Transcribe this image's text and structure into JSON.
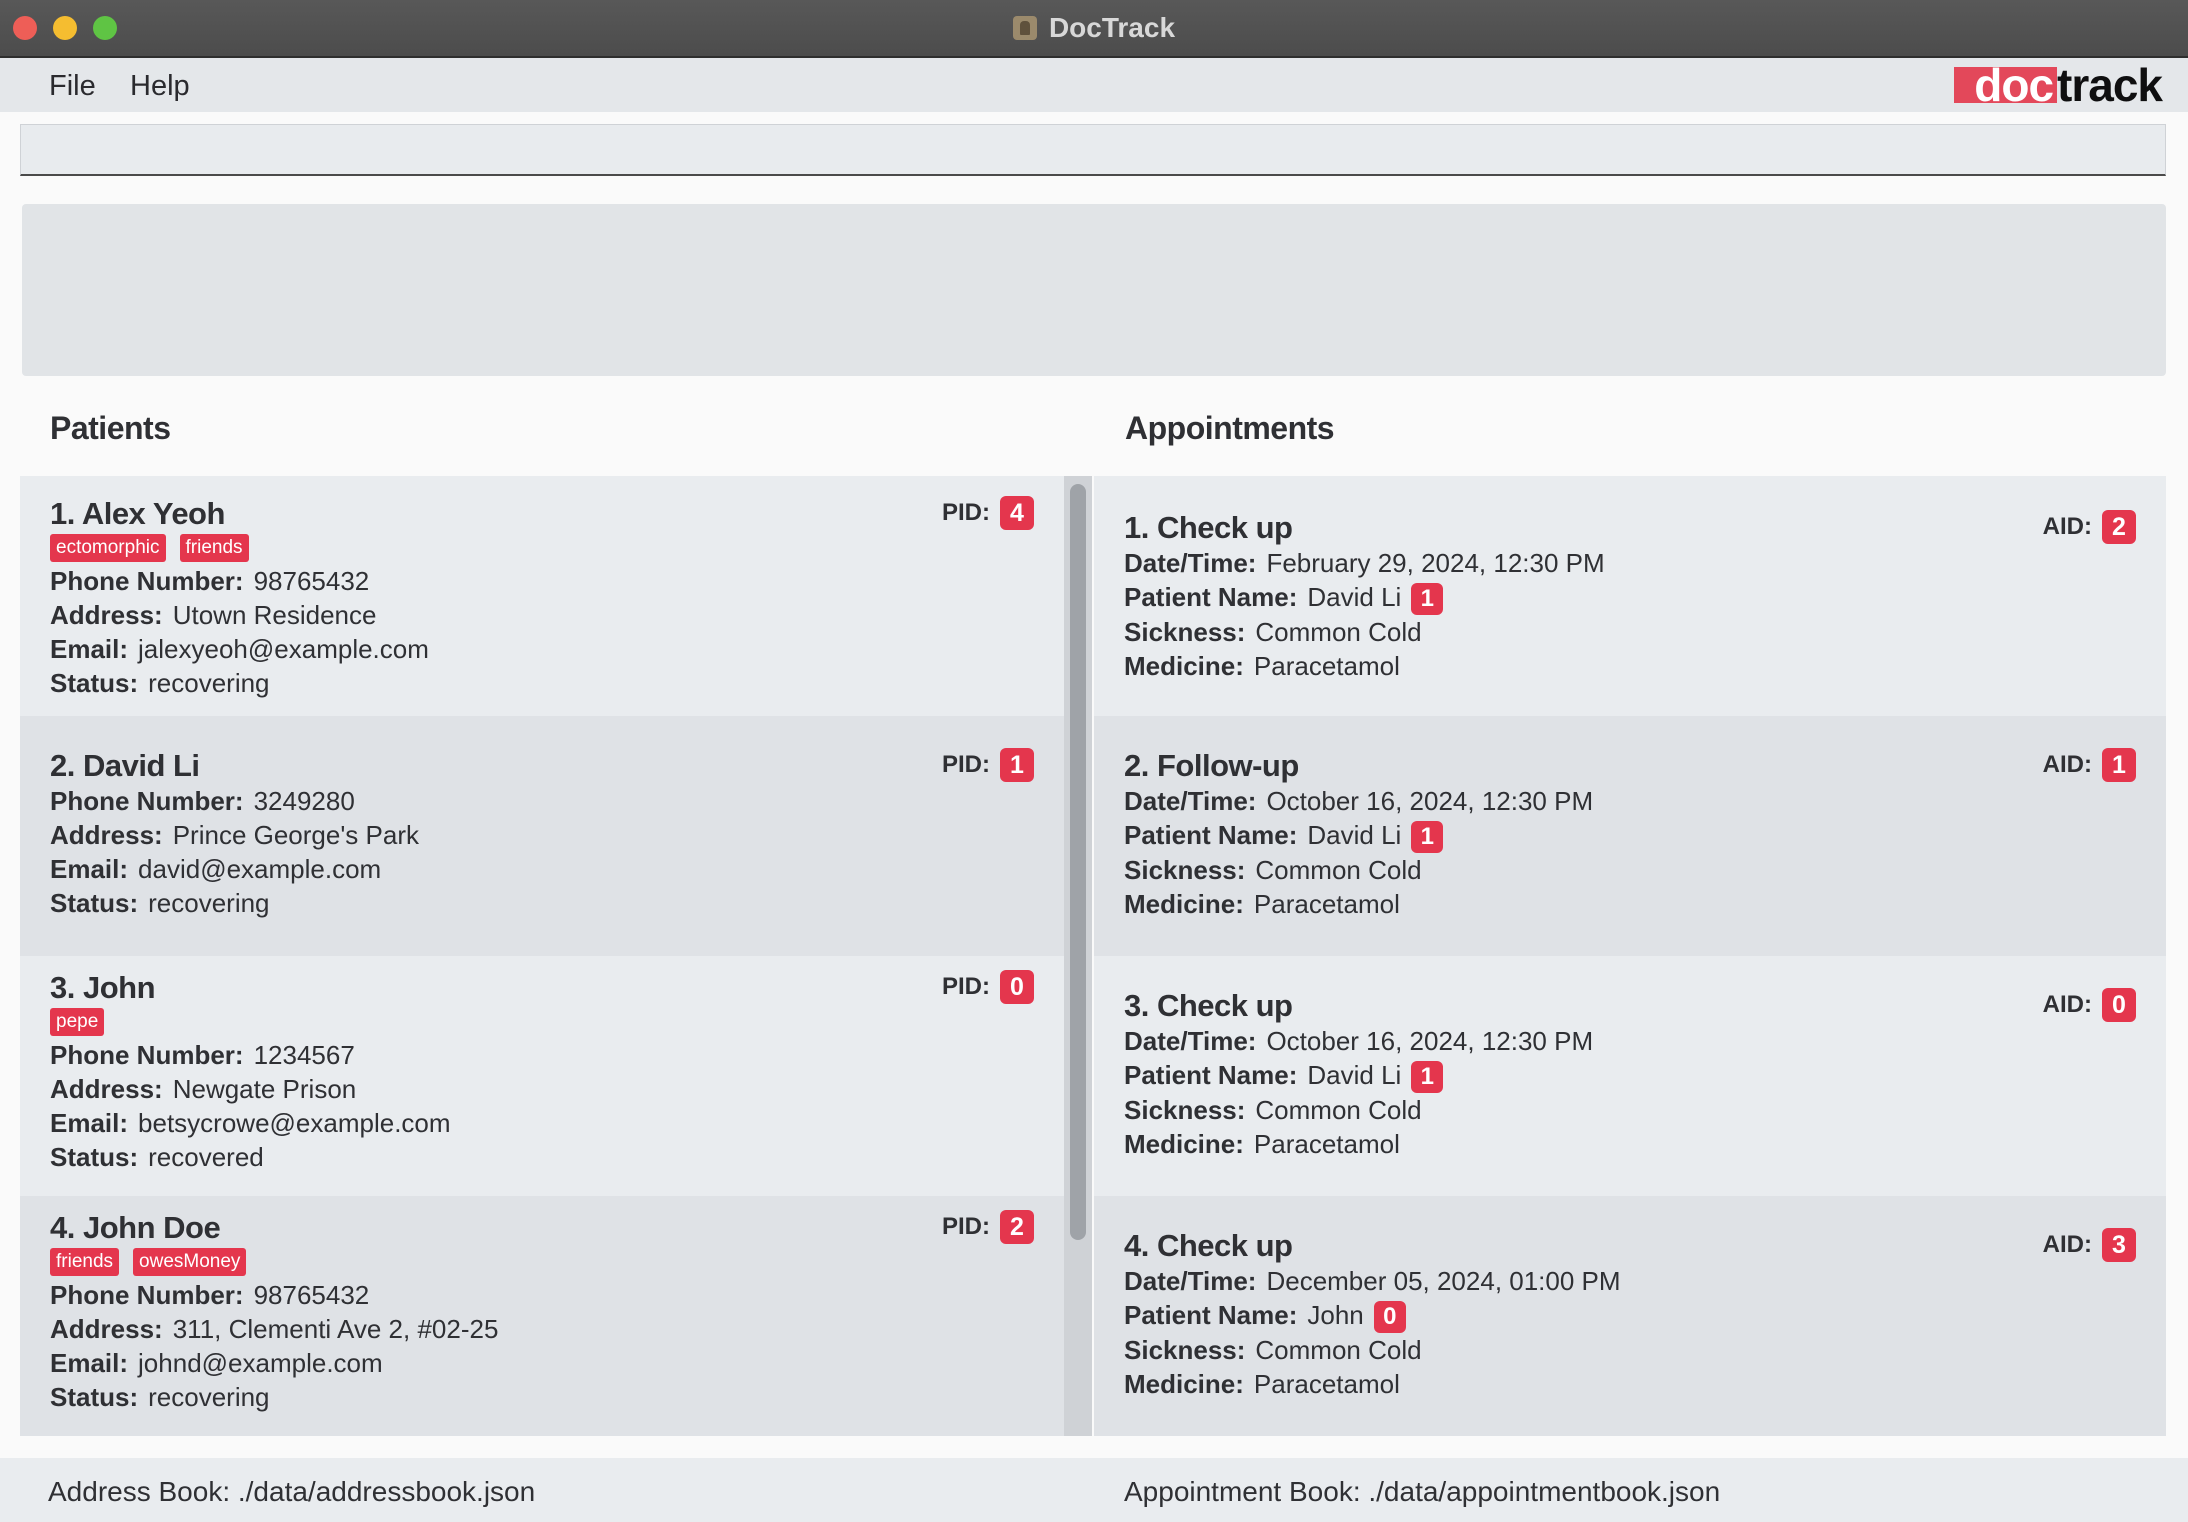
{
  "window": {
    "title": "DocTrack"
  },
  "menu": {
    "file": "File",
    "help": "Help"
  },
  "logo": {
    "doc": "doc",
    "track": "track"
  },
  "command_box": {
    "value": ""
  },
  "panels": {
    "patients_title": "Patients",
    "appointments_title": "Appointments"
  },
  "labels": {
    "pid": "PID:",
    "aid": "AID:",
    "phone": "Phone Number:",
    "address": "Address:",
    "email": "Email:",
    "status": "Status:",
    "datetime": "Date/Time:",
    "patient_name": "Patient Name:",
    "sickness": "Sickness:",
    "medicine": "Medicine:"
  },
  "patients": [
    {
      "title": "1. Alex Yeoh",
      "pid": "4",
      "tags": [
        "ectomorphic",
        "friends"
      ],
      "phone": "98765432",
      "address": "Utown Residence",
      "email": "jalexyeoh@example.com",
      "status": "recovering"
    },
    {
      "title": "2. David Li",
      "pid": "1",
      "tags": [],
      "phone": "3249280",
      "address": "Prince George's Park",
      "email": "david@example.com",
      "status": "recovering"
    },
    {
      "title": "3. John",
      "pid": "0",
      "tags": [
        "pepe"
      ],
      "phone": "1234567",
      "address": "Newgate Prison",
      "email": "betsycrowe@example.com",
      "status": "recovered"
    },
    {
      "title": "4. John Doe",
      "pid": "2",
      "tags": [
        "friends",
        "owesMoney"
      ],
      "phone": "98765432",
      "address": "311, Clementi Ave 2, #02-25",
      "email": "johnd@example.com",
      "status": "recovering"
    }
  ],
  "appointments": [
    {
      "title": "1. Check up",
      "aid": "2",
      "datetime": "February 29, 2024, 12:30 PM",
      "patient_name": "David Li",
      "patient_id": "1",
      "sickness": "Common Cold",
      "medicine": "Paracetamol"
    },
    {
      "title": "2. Follow-up",
      "aid": "1",
      "datetime": "October 16, 2024, 12:30 PM",
      "patient_name": "David Li",
      "patient_id": "1",
      "sickness": "Common Cold",
      "medicine": "Paracetamol"
    },
    {
      "title": "3. Check up",
      "aid": "0",
      "datetime": "October 16, 2024, 12:30 PM",
      "patient_name": "David Li",
      "patient_id": "1",
      "sickness": "Common Cold",
      "medicine": "Paracetamol"
    },
    {
      "title": "4. Check up",
      "aid": "3",
      "datetime": "December 05, 2024, 01:00 PM",
      "patient_name": "John",
      "patient_id": "0",
      "sickness": "Common Cold",
      "medicine": "Paracetamol"
    }
  ],
  "status": {
    "address_book": "Address Book: ./data/addressbook.json",
    "appointment_book": "Appointment Book: ./data/appointmentbook.json"
  },
  "colors": {
    "accent": "#e4364d",
    "logo_red": "#e3485a",
    "titlebar": "#4f4f4f"
  }
}
